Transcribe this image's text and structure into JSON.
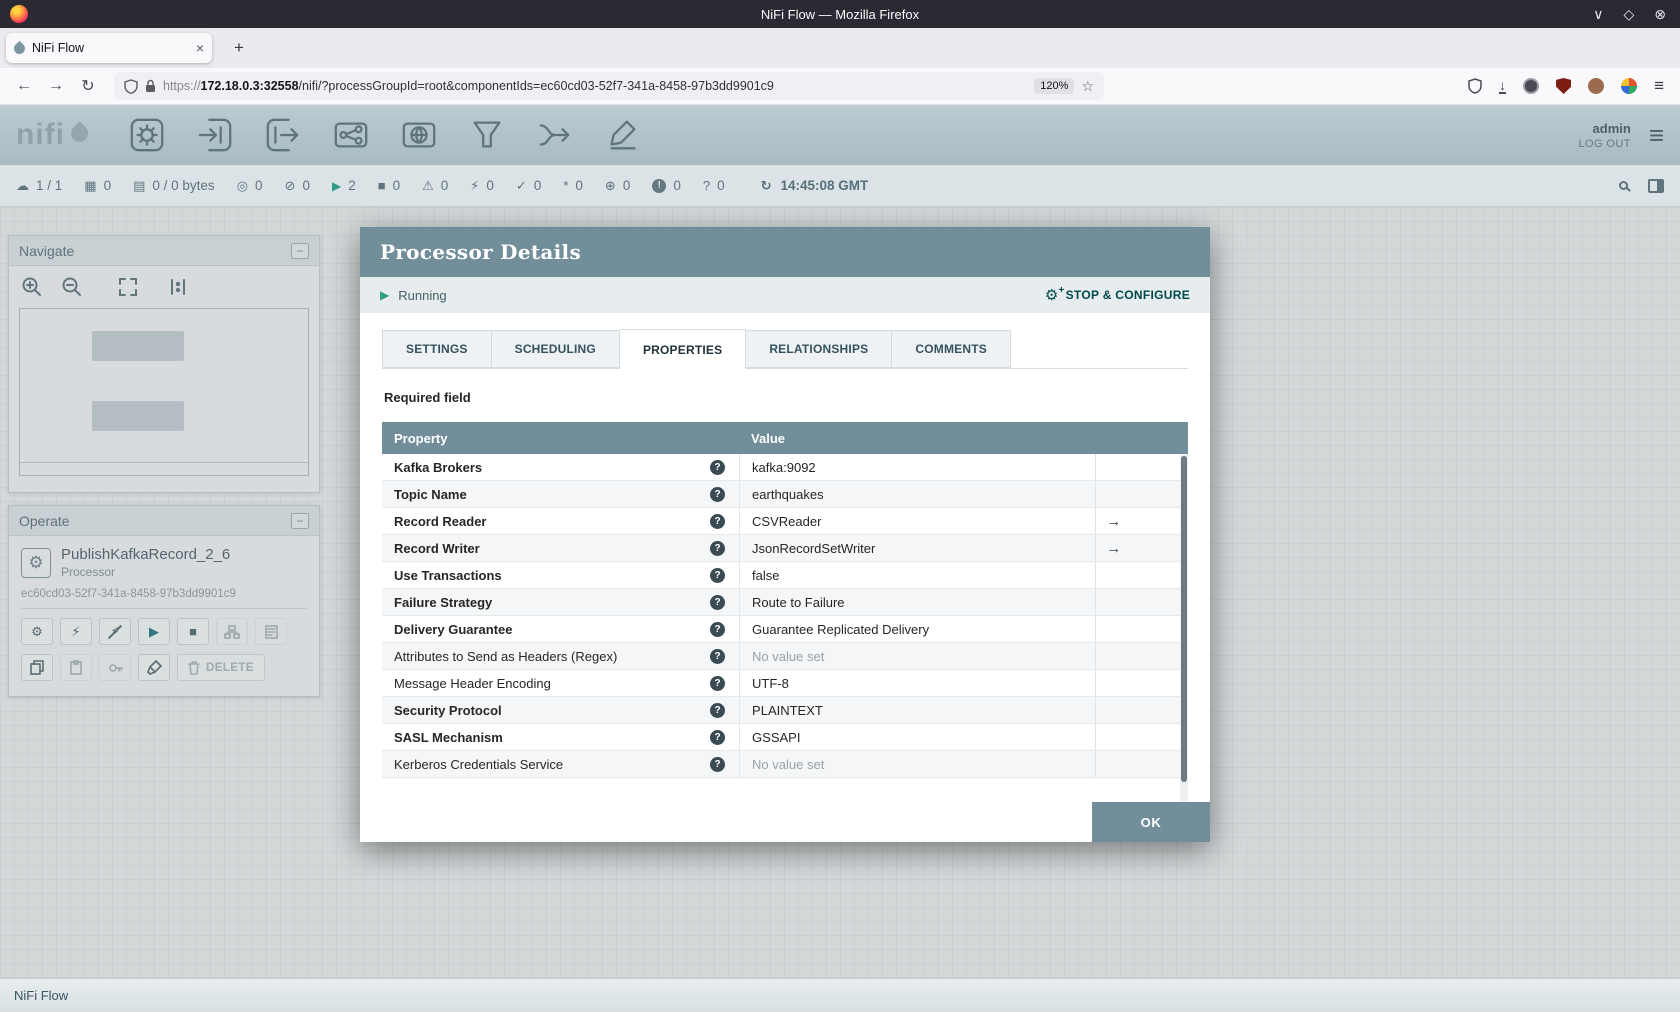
{
  "icons": {
    "chevron_down": "∨",
    "diamond": "◇",
    "circle_close": "⊗",
    "close": "×",
    "plus": "+",
    "back": "←",
    "forward": "→",
    "reload": "↻",
    "star": "☆",
    "menu": "≡",
    "download": "↓",
    "cluster": "☁",
    "threads": "▦",
    "queued": "▤",
    "transmitting": "◎",
    "not_transmitting": "⊘",
    "running": "▶",
    "stopped": "■",
    "invalid": "⚠",
    "disabled": "⚡",
    "up_to_date": "✓",
    "locally_modified": "*",
    "stale": "⊕",
    "locally_modified_stale": "!",
    "sync_failure": "?",
    "refresh": "↻",
    "gear": "⚙",
    "bolt": "⚡",
    "play": "▶",
    "stop": "■",
    "arrow_right": "→",
    "help": "?",
    "collapse": "−"
  },
  "browser": {
    "window_title": "NiFi Flow — Mozilla Firefox",
    "tab_title": "NiFi Flow",
    "url_scheme": "https://",
    "url_host": "172.18.0.3:32558",
    "url_path": "/nifi/?processGroupId=root&componentIds=ec60cd03-52f7-341a-8458-97b3dd9901c9",
    "zoom_level": "120%"
  },
  "nifi": {
    "logo_text": "nifi",
    "user": "admin",
    "logout_label": "LOG OUT"
  },
  "status_bar": {
    "items": [
      {
        "name": "connected-nodes",
        "value": "1 / 1"
      },
      {
        "name": "active-threads",
        "value": "0"
      },
      {
        "name": "total-queued",
        "value": "0 / 0 bytes"
      },
      {
        "name": "transmitting-remote-groups",
        "value": "0"
      },
      {
        "name": "not-transmitting-remote-groups",
        "value": "0"
      },
      {
        "name": "running-components",
        "value": "2"
      },
      {
        "name": "stopped-components",
        "value": "0"
      },
      {
        "name": "invalid-components",
        "value": "0"
      },
      {
        "name": "disabled-components",
        "value": "0"
      },
      {
        "name": "up-to-date-versioned",
        "value": "0"
      },
      {
        "name": "locally-modified-versioned",
        "value": "0"
      },
      {
        "name": "stale-versioned",
        "value": "0"
      },
      {
        "name": "locally-modified-and-stale-versioned",
        "value": "0"
      },
      {
        "name": "sync-failure-versioned",
        "value": "0"
      }
    ],
    "last_refresh": "14:45:08 GMT"
  },
  "navigate": {
    "title": "Navigate"
  },
  "operate": {
    "title": "Operate",
    "component_name": "PublishKafkaRecord_2_6",
    "component_type": "Processor",
    "component_id": "ec60cd03-52f7-341a-8458-97b3dd9901c9",
    "delete_label": "DELETE"
  },
  "modal": {
    "title": "Processor Details",
    "status_label": "Running",
    "stop_configure_label": "STOP & CONFIGURE",
    "tabs": [
      {
        "label": "SETTINGS"
      },
      {
        "label": "SCHEDULING"
      },
      {
        "label": "PROPERTIES"
      },
      {
        "label": "RELATIONSHIPS"
      },
      {
        "label": "COMMENTS"
      }
    ],
    "active_tab": "PROPERTIES",
    "required_note": "Required field",
    "table": {
      "columns": [
        {
          "label": "Property"
        },
        {
          "label": "Value"
        }
      ],
      "rows": [
        {
          "property": "Kafka Brokers",
          "value": "kafka:9092",
          "required": true,
          "empty": false,
          "has_link": false
        },
        {
          "property": "Topic Name",
          "value": "earthquakes",
          "required": true,
          "empty": false,
          "has_link": false
        },
        {
          "property": "Record Reader",
          "value": "CSVReader",
          "required": true,
          "empty": false,
          "has_link": true
        },
        {
          "property": "Record Writer",
          "value": "JsonRecordSetWriter",
          "required": true,
          "empty": false,
          "has_link": true
        },
        {
          "property": "Use Transactions",
          "value": "false",
          "required": true,
          "empty": false,
          "has_link": false
        },
        {
          "property": "Failure Strategy",
          "value": "Route to Failure",
          "required": true,
          "empty": false,
          "has_link": false
        },
        {
          "property": "Delivery Guarantee",
          "value": "Guarantee Replicated Delivery",
          "required": true,
          "empty": false,
          "has_link": false
        },
        {
          "property": "Attributes to Send as Headers (Regex)",
          "value": "No value set",
          "required": false,
          "empty": true,
          "has_link": false
        },
        {
          "property": "Message Header Encoding",
          "value": "UTF-8",
          "required": false,
          "empty": false,
          "has_link": false
        },
        {
          "property": "Security Protocol",
          "value": "PLAINTEXT",
          "required": true,
          "empty": false,
          "has_link": false
        },
        {
          "property": "SASL Mechanism",
          "value": "GSSAPI",
          "required": true,
          "empty": false,
          "has_link": false
        },
        {
          "property": "Kerberos Credentials Service",
          "value": "No value set",
          "required": false,
          "empty": true,
          "has_link": false
        }
      ]
    },
    "ok_label": "OK"
  },
  "footer": {
    "breadcrumb": "NiFi Flow"
  }
}
